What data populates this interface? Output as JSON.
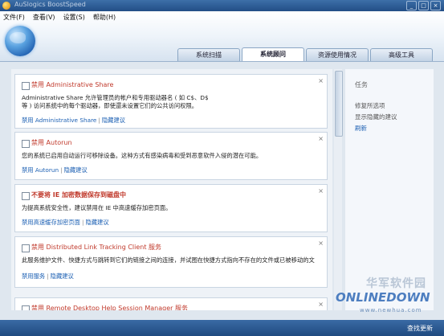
{
  "window": {
    "title": "AuSlogics BoostSpeed"
  },
  "menu": [
    "文件(F)",
    "查看(V)",
    "设置(S)",
    "帮助(H)"
  ],
  "tabs": [
    {
      "label": "系统扫描",
      "active": false
    },
    {
      "label": "系统顾问",
      "active": true
    },
    {
      "label": "资源使用情况",
      "active": false
    },
    {
      "label": "高级工具",
      "active": false
    }
  ],
  "cards": [
    {
      "title": "禁用 Administrative Share",
      "bold": false,
      "desc_line1": "Administrative Share 允许管理员的帐户和专用驱动器名 ( 如 C$、D$",
      "desc_line2": "等 ) 访问系统中的每个驱动器，即使還未设置它们的公共访问权限。",
      "link_primary": "禁用 Administrative Share",
      "link_secondary": "隐藏建议"
    },
    {
      "title": "禁用 Autorun",
      "bold": false,
      "desc_line1": "您的系统已启用自动运行可移除设备。这种方式有感染病毒和受到恶意软件入侵的潜在可能。",
      "desc_line2": "",
      "link_primary": "禁用 Autorun",
      "link_secondary": "隐藏建议"
    },
    {
      "title": "不要将 IE 加密数据保存到磁盘中",
      "bold": true,
      "desc_line1": "为提高系统安全性，建议禁用在 IE 中高速缓存加密页面。",
      "desc_line2": "",
      "link_primary": "禁用高速缓存加密页面",
      "link_secondary": "隐藏建议"
    },
    {
      "title": "禁用 Distributed Link Tracking Client 服务",
      "bold": false,
      "desc_line1": "此服务维护文件、快捷方式与跳转到它们的链接之间的连接，并试图在快捷方式指向不存在的文件或已被移动的文",
      "desc_line2": "",
      "link_primary": "禁用服务",
      "link_secondary": "隐藏建议"
    },
    {
      "title": "禁用 Remote Desktop Help Session Manager 服务",
      "bold": false,
      "desc_line1": "",
      "desc_line2": "",
      "link_primary": "",
      "link_secondary": ""
    }
  ],
  "close_glyph": "×",
  "link_separator": "|",
  "taskpane": {
    "heading": "任务",
    "items": [
      {
        "label": "修复所选项",
        "link": false
      },
      {
        "label": "显示隐藏的建议",
        "link": false
      },
      {
        "label": "刷新",
        "link": true
      }
    ]
  },
  "statusbar": {
    "action": "查找更新"
  },
  "watermark": {
    "cn": "华军软件园",
    "en": "ONLINEDOWN",
    "url": "www.newhua.com"
  },
  "colors": {
    "title_red": "#c0392b",
    "link_blue": "#1b5fb3",
    "frame_blue": "#224e86"
  }
}
